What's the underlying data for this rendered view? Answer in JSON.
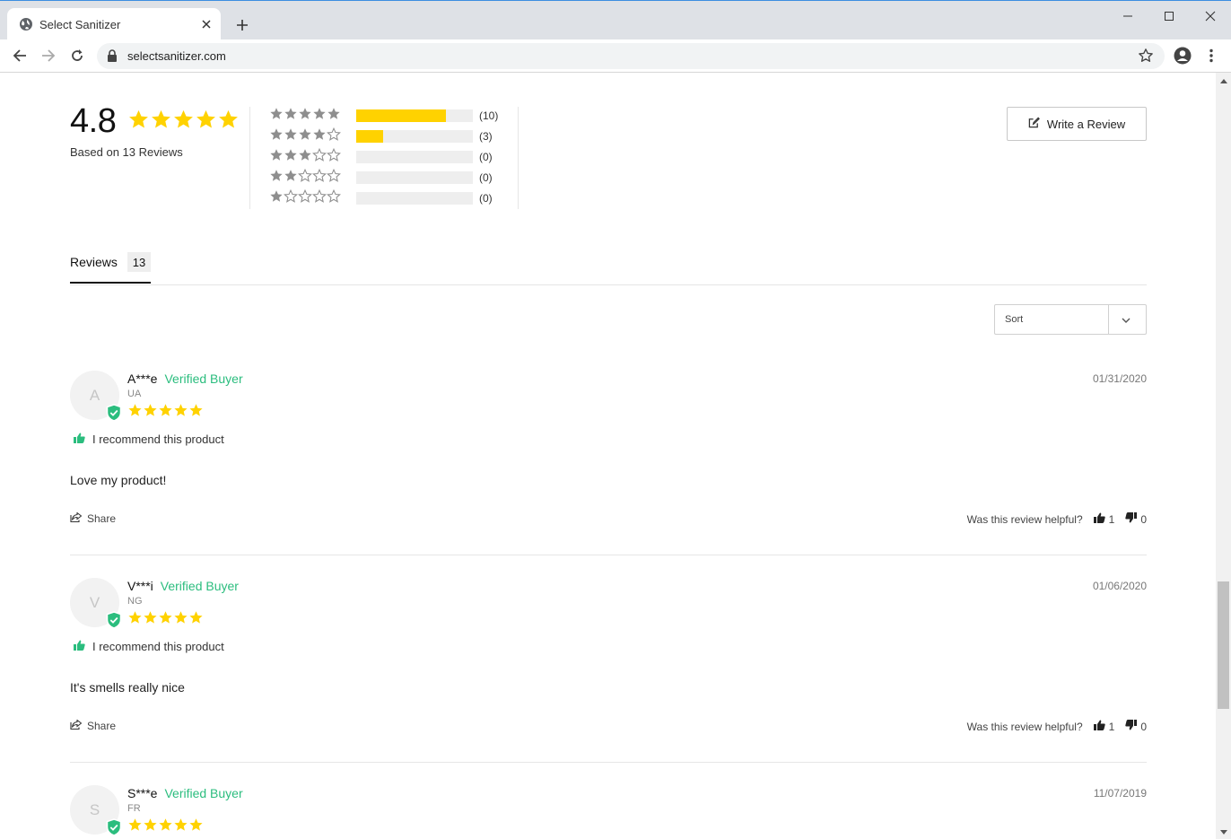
{
  "browser": {
    "tab_title": "Select Sanitizer",
    "url": "selectsanitizer.com"
  },
  "summary": {
    "average": "4.8",
    "average_stars": 5,
    "based_on": "Based on 13 Reviews",
    "write_review_label": "Write a Review",
    "histogram": [
      {
        "stars": 5,
        "count_label": "(10)",
        "fraction": 0.77
      },
      {
        "stars": 4,
        "count_label": "(3)",
        "fraction": 0.23
      },
      {
        "stars": 3,
        "count_label": "(0)",
        "fraction": 0
      },
      {
        "stars": 2,
        "count_label": "(0)",
        "fraction": 0
      },
      {
        "stars": 1,
        "count_label": "(0)",
        "fraction": 0
      }
    ]
  },
  "tabs": {
    "reviews_label": "Reviews",
    "reviews_count": "13"
  },
  "sort": {
    "label": "Sort"
  },
  "reviews": [
    {
      "initial": "A",
      "name": "A***e",
      "verified": "Verified Buyer",
      "location": "UA",
      "stars": 5,
      "date": "01/31/2020",
      "recommend": "I recommend this product",
      "body": "Love my product!",
      "share": "Share",
      "helpful_q": "Was this review helpful?",
      "up": "1",
      "down": "0"
    },
    {
      "initial": "V",
      "name": "V***i",
      "verified": "Verified Buyer",
      "location": "NG",
      "stars": 5,
      "date": "01/06/2020",
      "recommend": "I recommend this product",
      "body": "It's smells really nice",
      "share": "Share",
      "helpful_q": "Was this review helpful?",
      "up": "1",
      "down": "0"
    },
    {
      "initial": "S",
      "name": "S***e",
      "verified": "Verified Buyer",
      "location": "FR",
      "stars": 5,
      "date": "11/07/2019"
    }
  ],
  "colors": {
    "star_gold": "#ffd200",
    "star_empty_gray": "#9a9a9a",
    "verified_green": "#2bbd7e"
  }
}
